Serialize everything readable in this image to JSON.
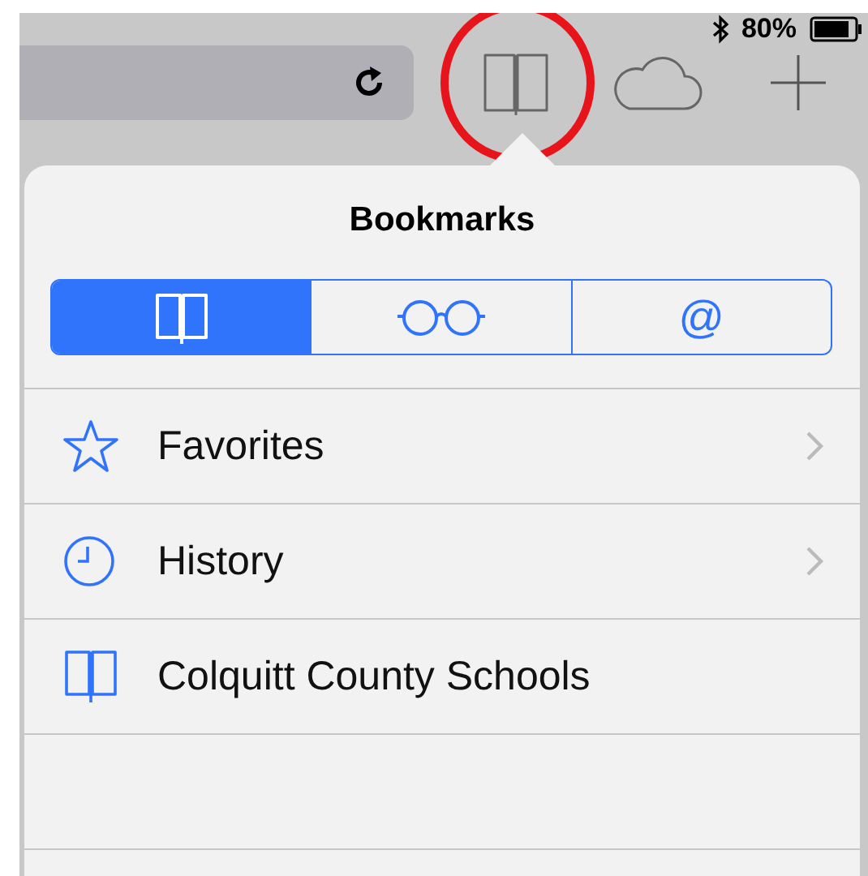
{
  "status_bar": {
    "battery_text": "80%",
    "bluetooth": true
  },
  "toolbar": {
    "buttons": [
      {
        "kind": "book",
        "circled": true
      },
      {
        "kind": "cloud",
        "circled": false
      },
      {
        "kind": "plus",
        "circled": false
      }
    ]
  },
  "popover": {
    "title": "Bookmarks",
    "segments": [
      {
        "kind": "book",
        "selected": true
      },
      {
        "kind": "glasses",
        "selected": false
      },
      {
        "kind": "at",
        "label": "@",
        "selected": false
      }
    ],
    "items": [
      {
        "kind": "star",
        "label": "Favorites",
        "chevron": true
      },
      {
        "kind": "clock",
        "label": "History",
        "chevron": true
      },
      {
        "kind": "book",
        "label": "Colquitt County Schools",
        "chevron": false
      }
    ]
  }
}
